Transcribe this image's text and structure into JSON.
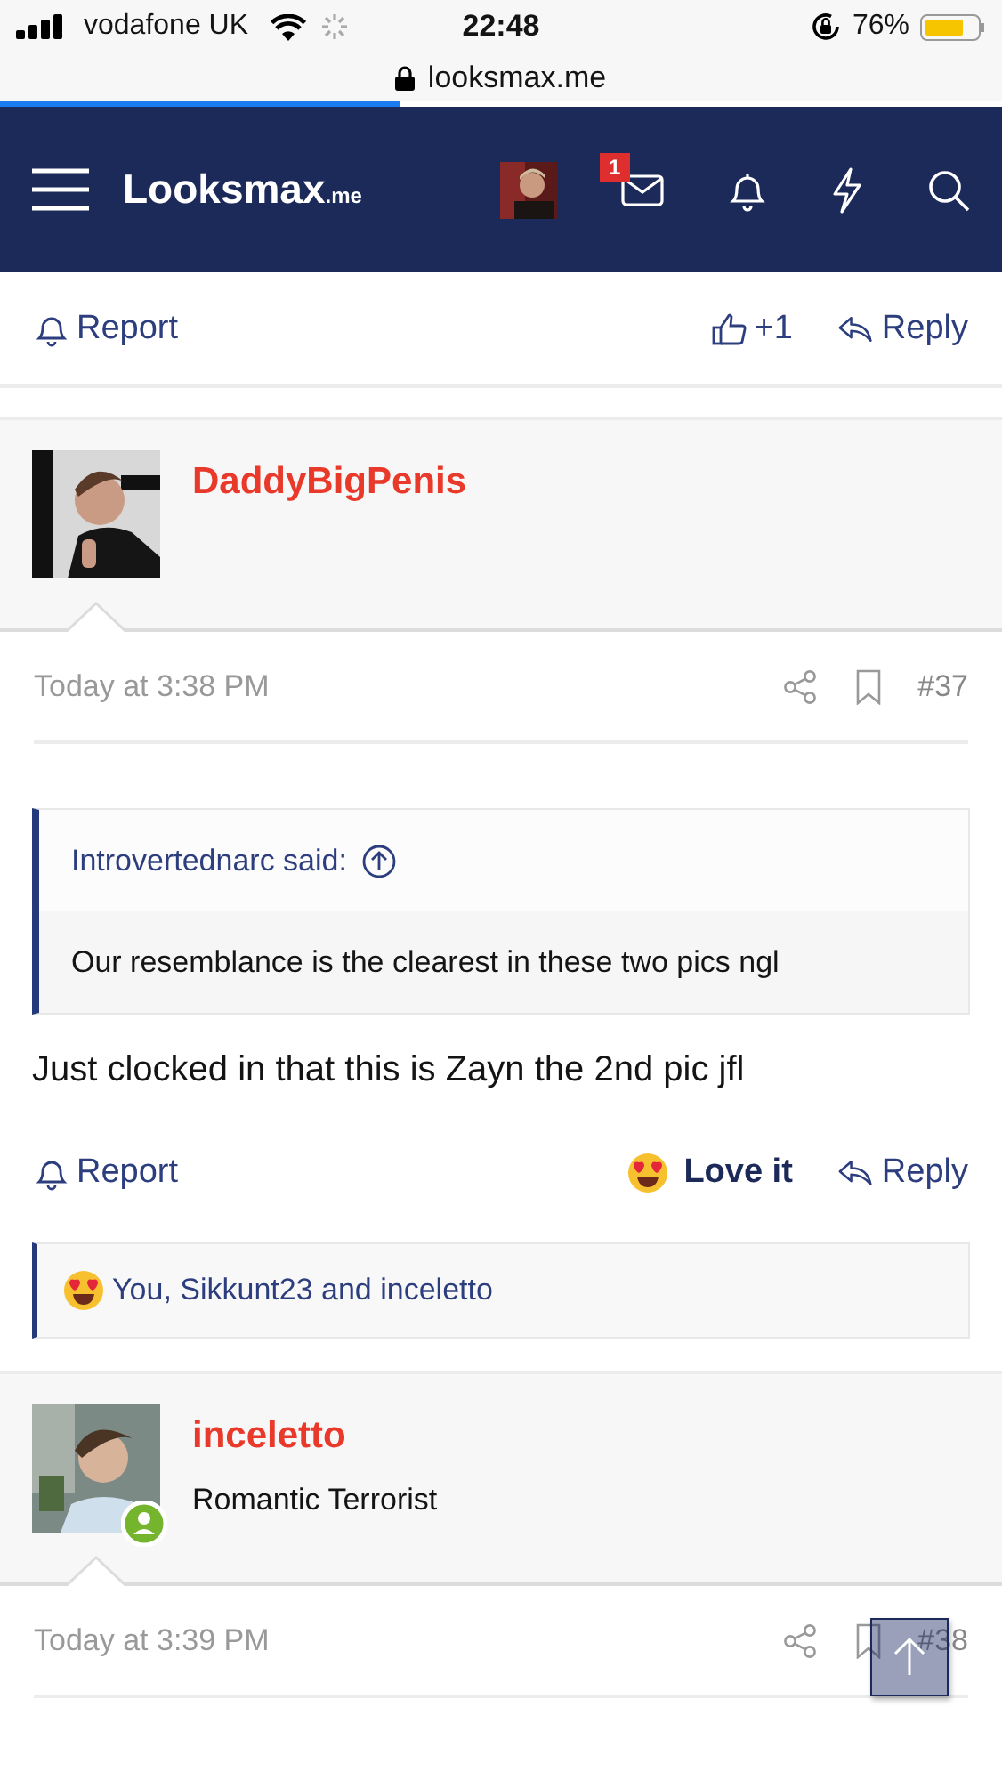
{
  "status_bar": {
    "carrier": "vodafone UK",
    "time": "22:48",
    "battery": "76%"
  },
  "address_bar": {
    "url": "looksmax.me",
    "level": 0.4
  },
  "nav": {
    "logo": "Looksmax",
    "logo_suffix": ".me",
    "inbox_badge": "1"
  },
  "top_actions": {
    "report": "Report",
    "like": "+1",
    "reply": "Reply"
  },
  "posts": [
    {
      "author": "DaddyBigPenis",
      "online": false,
      "time": "Today at 3:38 PM",
      "number": "#37",
      "quote": {
        "author": "Introvertednarc said:",
        "text": "Our resemblance is the clearest in these two pics ngl"
      },
      "body": "Just clocked in that this is Zayn the 2nd pic jfl",
      "actions": {
        "report": "Report",
        "reaction": "Love it",
        "reacted": true,
        "reply": "Reply"
      },
      "reactions": "You, Sikkunt23 and inceletto"
    },
    {
      "author": "inceletto",
      "user_title": "Romantic Terrorist",
      "online": true,
      "time": "Today at 3:39 PM",
      "number": "#38"
    }
  ]
}
